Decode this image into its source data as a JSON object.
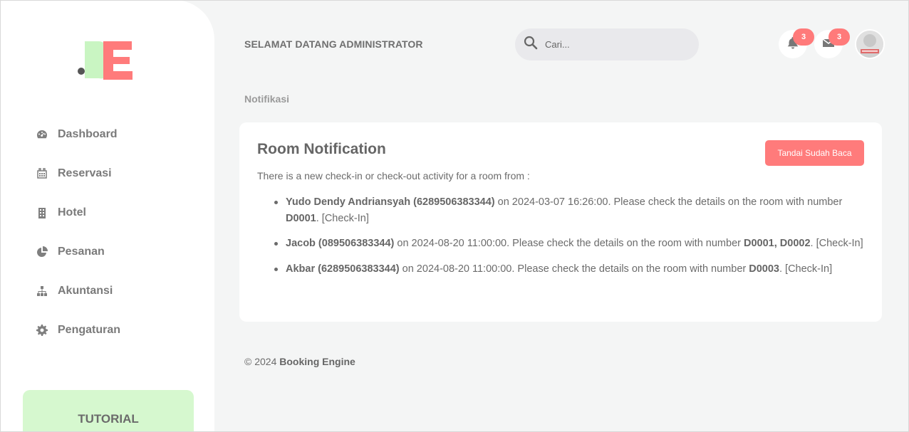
{
  "brand": {
    "logo_text": "BE",
    "logo_dot": "."
  },
  "sidebar": {
    "items": [
      {
        "label": "Dashboard",
        "icon": "gauge-icon"
      },
      {
        "label": "Reservasi",
        "icon": "calendar-icon"
      },
      {
        "label": "Hotel",
        "icon": "building-icon"
      },
      {
        "label": "Pesanan",
        "icon": "pie-chart-icon"
      },
      {
        "label": "Akuntansi",
        "icon": "sitemap-icon"
      },
      {
        "label": "Pengaturan",
        "icon": "gear-icon"
      }
    ],
    "tutorial_label": "TUTORIAL"
  },
  "header": {
    "welcome": "SELAMAT DATANG ADMINISTRATOR",
    "search_placeholder": "Cari...",
    "notifications_count": "3",
    "messages_count": "3"
  },
  "breadcrumb": "Notifikasi",
  "card": {
    "title": "Room Notification",
    "mark_read_label": "Tandai Sudah Baca",
    "intro": "There is a new check-in or check-out activity for a room from :",
    "items": [
      {
        "guest": "Yudo Dendy Andriansyah (6289506383344)",
        "middle": " on 2024-03-07 16:26:00. Please check the details on the room with number ",
        "rooms": "D0001",
        "status": ". [Check-In]"
      },
      {
        "guest": "Jacob (089506383344)",
        "middle": " on 2024-08-20 11:00:00. Please check the details on the room with number ",
        "rooms": "D0001, D0002",
        "status": ". [Check-In]"
      },
      {
        "guest": "Akbar (6289506383344)",
        "middle": " on 2024-08-20 11:00:00. Please check the details on the room with number ",
        "rooms": "D0003",
        "status": ". [Check-In]"
      }
    ]
  },
  "footer": {
    "copyright": "© 2024 ",
    "brand": "Booking Engine"
  },
  "colors": {
    "accent": "#ff7b7b",
    "green": "#c9f5c2",
    "badge": "#ff7a7a",
    "tutorial_bg": "#d6f8cf"
  }
}
